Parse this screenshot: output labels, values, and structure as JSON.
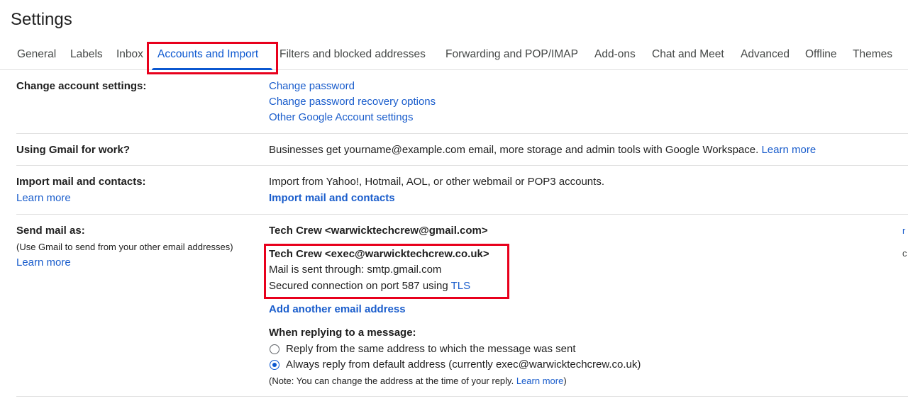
{
  "page": {
    "title": "Settings"
  },
  "tabs": [
    {
      "label": "General"
    },
    {
      "label": "Labels"
    },
    {
      "label": "Inbox"
    },
    {
      "label": "Accounts and Import",
      "active": true
    },
    {
      "label": "Filters and blocked addresses"
    },
    {
      "label": "Forwarding and POP/IMAP"
    },
    {
      "label": "Add-ons"
    },
    {
      "label": "Chat and Meet"
    },
    {
      "label": "Advanced"
    },
    {
      "label": "Offline"
    },
    {
      "label": "Themes"
    }
  ],
  "change_account": {
    "label": "Change account settings:",
    "links": [
      "Change password",
      "Change password recovery options",
      "Other Google Account settings"
    ]
  },
  "gmail_work": {
    "label": "Using Gmail for work?",
    "text": "Businesses get yourname@example.com email, more storage and admin tools with Google Workspace.",
    "link": "Learn more"
  },
  "import_mail": {
    "label": "Import mail and contacts:",
    "learn_more": "Learn more",
    "text": "Import from Yahoo!, Hotmail, AOL, or other webmail or POP3 accounts.",
    "action": "Import mail and contacts"
  },
  "send_mail": {
    "label": "Send mail as:",
    "sublabel": "(Use Gmail to send from your other email addresses)",
    "learn_more": "Learn more",
    "address1": "Tech Crew <warwicktechcrew@gmail.com>",
    "address2": "Tech Crew <exec@warwicktechcrew.co.uk>",
    "smtp": "Mail is sent through: smtp.gmail.com",
    "secured": "Secured connection on port 587 using",
    "tls": "TLS",
    "add_address": "Add another email address",
    "reply_heading": "When replying to a message:",
    "reply_options": [
      {
        "label": "Reply from the same address to which the message was sent",
        "checked": false
      },
      {
        "label": "Always reply from default address (currently exec@warwicktechcrew.co.uk)",
        "checked": true
      }
    ],
    "note_prefix": "(Note: You can change the address at the time of your reply.",
    "note_link": "Learn more",
    "note_suffix": ")",
    "right_edge_1": "r",
    "right_edge_2": "c"
  },
  "colors": {
    "accent": "#0b57d0",
    "link": "#1a5dcc",
    "highlight": "#e8001c",
    "divider": "#e0e0e0"
  }
}
